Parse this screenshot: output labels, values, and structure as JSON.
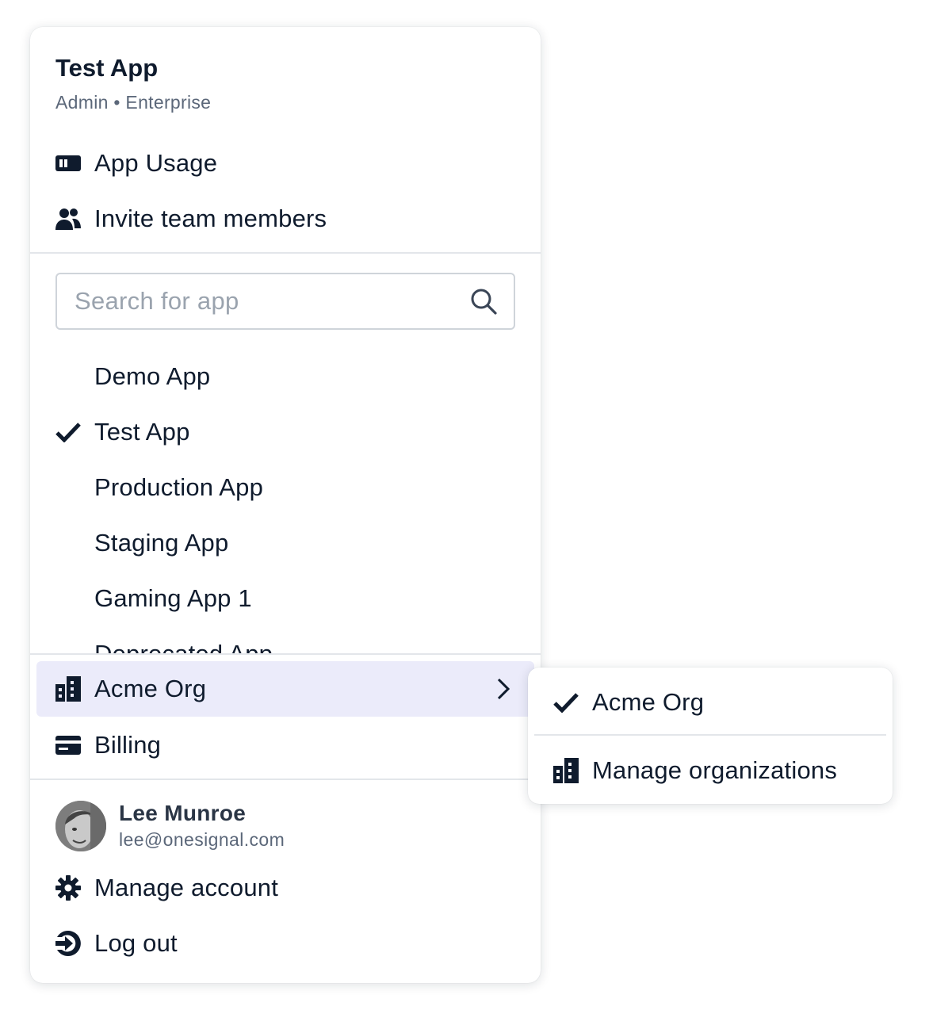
{
  "header": {
    "title": "Test App",
    "subtitle": "Admin • Enterprise"
  },
  "top_actions": [
    {
      "label": "App Usage",
      "icon": "usage-icon"
    },
    {
      "label": "Invite team members",
      "icon": "users-icon"
    }
  ],
  "search": {
    "placeholder": "Search for app",
    "value": ""
  },
  "apps": [
    {
      "label": "Demo App",
      "selected": false
    },
    {
      "label": "Test App",
      "selected": true
    },
    {
      "label": "Production App",
      "selected": false
    },
    {
      "label": "Staging App",
      "selected": false
    },
    {
      "label": "Gaming App 1",
      "selected": false
    },
    {
      "label": "Deprecated App",
      "selected": false
    }
  ],
  "org": {
    "label": "Acme Org",
    "icon": "building-icon",
    "highlight_color": "#ebebfa"
  },
  "billing": {
    "label": "Billing",
    "icon": "credit-card-icon"
  },
  "user": {
    "name": "Lee Munroe",
    "email": "lee@onesignal.com"
  },
  "account_actions": [
    {
      "label": "Manage account",
      "icon": "gear-icon"
    },
    {
      "label": "Log out",
      "icon": "logout-icon"
    }
  ],
  "org_submenu": {
    "current": "Acme Org",
    "manage_label": "Manage organizations"
  },
  "colors": {
    "text": "#0f1b2d",
    "muted": "#5b6779",
    "divider": "#e3e6ea"
  }
}
